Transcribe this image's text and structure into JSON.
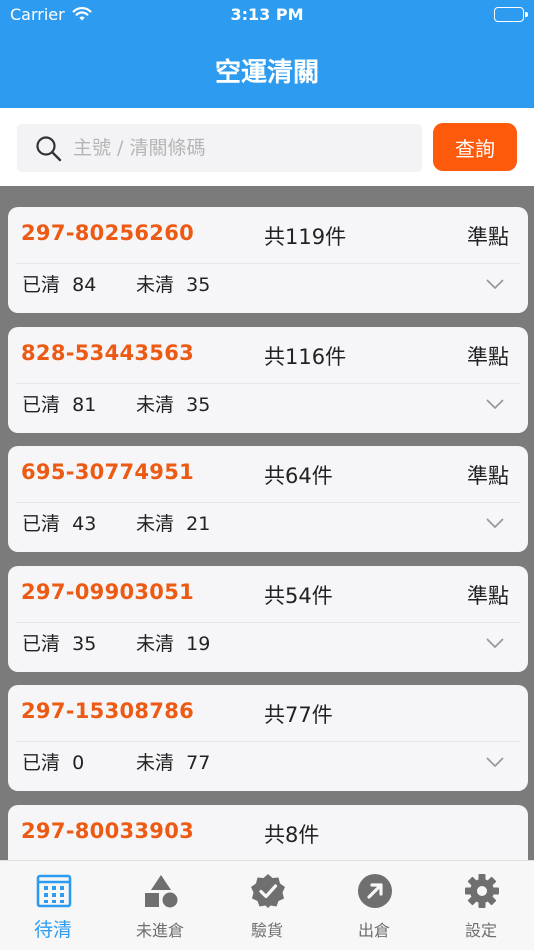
{
  "status_bar": {
    "carrier": "Carrier",
    "time": "3:13 PM"
  },
  "header": {
    "title": "空運清關"
  },
  "search": {
    "placeholder": "主號 / 清關條碼",
    "button_label": "查詢"
  },
  "colors": {
    "brand": "#2d9cf0",
    "accent": "#fe5a0c",
    "awb": "#ec5a14"
  },
  "shipments": [
    {
      "awb": "297-80256260",
      "total": "共119件",
      "status": "準點",
      "cleared_label": "已清",
      "cleared": "84",
      "uncleared_label": "未清",
      "uncleared": "35"
    },
    {
      "awb": "828-53443563",
      "total": "共116件",
      "status": "準點",
      "cleared_label": "已清",
      "cleared": "81",
      "uncleared_label": "未清",
      "uncleared": "35"
    },
    {
      "awb": "695-30774951",
      "total": "共64件",
      "status": "準點",
      "cleared_label": "已清",
      "cleared": "43",
      "uncleared_label": "未清",
      "uncleared": "21"
    },
    {
      "awb": "297-09903051",
      "total": "共54件",
      "status": "準點",
      "cleared_label": "已清",
      "cleared": "35",
      "uncleared_label": "未清",
      "uncleared": "19"
    },
    {
      "awb": "297-15308786",
      "total": "共77件",
      "status": "",
      "cleared_label": "已清",
      "cleared": "0",
      "uncleared_label": "未清",
      "uncleared": "77"
    },
    {
      "awb": "297-80033903",
      "total": "共8件",
      "status": "",
      "cleared_label": "",
      "cleared": "",
      "uncleared_label": "",
      "uncleared": ""
    }
  ],
  "tabs": [
    {
      "label": "待清",
      "icon": "grid-calendar-icon",
      "active": true
    },
    {
      "label": "未進倉",
      "icon": "shapes-icon",
      "active": false
    },
    {
      "label": "驗貨",
      "icon": "verified-badge-icon",
      "active": false
    },
    {
      "label": "出倉",
      "icon": "arrow-up-right-circle-icon",
      "active": false
    },
    {
      "label": "設定",
      "icon": "gear-icon",
      "active": false
    }
  ]
}
